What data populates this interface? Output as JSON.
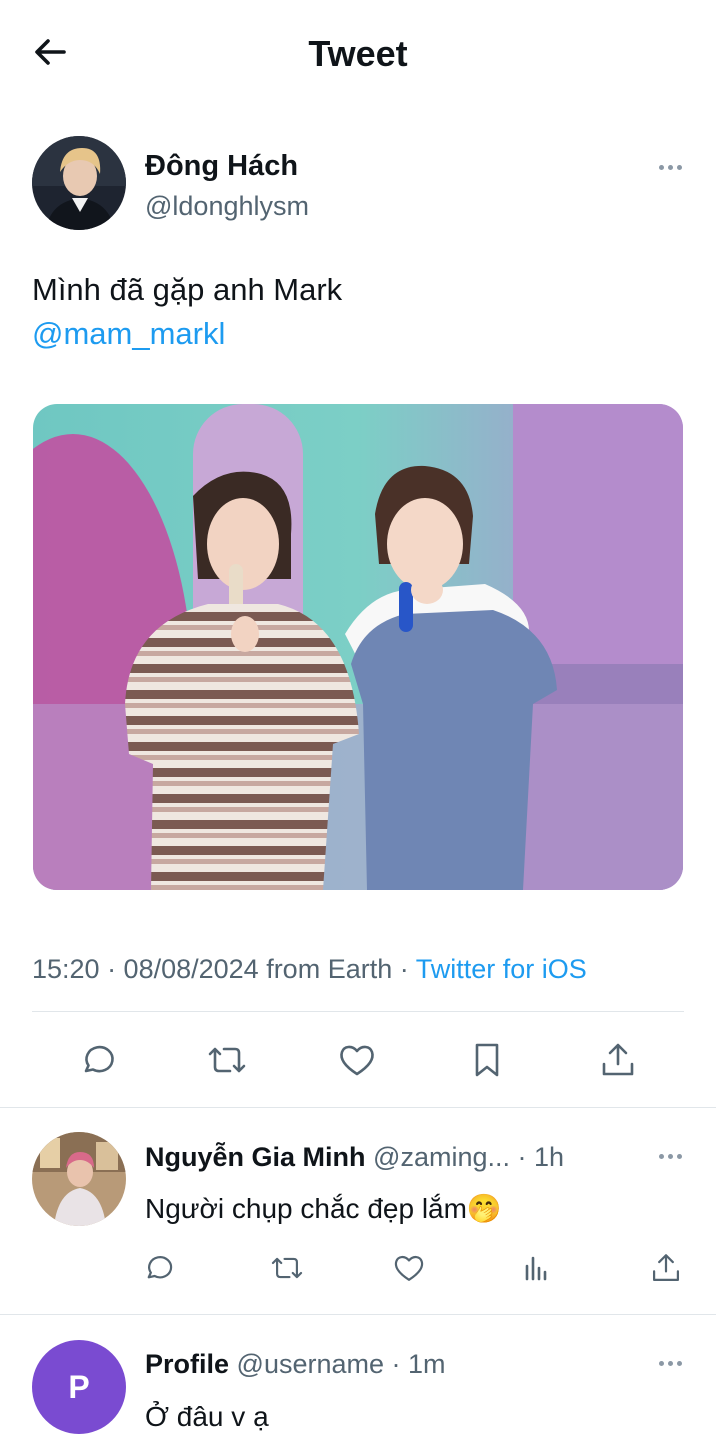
{
  "header": {
    "title": "Tweet",
    "back_icon": "arrow-left-icon"
  },
  "tweet": {
    "author_name": "Đông Hách",
    "author_handle": "@ldonghlysm",
    "text": "Mình đã gặp anh Mark",
    "mention": "@mam_markl",
    "timestamp": "15:20 · 08/08/2024 from Earth · ",
    "source": "Twitter for iOS",
    "actions": [
      "reply-icon",
      "retweet-icon",
      "like-icon",
      "bookmark-icon",
      "share-icon"
    ]
  },
  "replies": [
    {
      "name": "Nguyễn Gia Minh",
      "handle": "@zaming...",
      "time": " · 1h",
      "text": "Người chụp chắc đẹp lắm🤭",
      "actions": [
        "reply-icon",
        "retweet-icon",
        "like-icon",
        "views-icon",
        "share-icon"
      ]
    },
    {
      "name": "Profile",
      "handle": "@username",
      "time": " · 1m",
      "text": "Ở đâu v ạ",
      "avatar_letter": "P"
    }
  ],
  "colors": {
    "accent": "#1d9bf0",
    "muted": "#536471",
    "profile_avatar": "#7a4bd1"
  }
}
